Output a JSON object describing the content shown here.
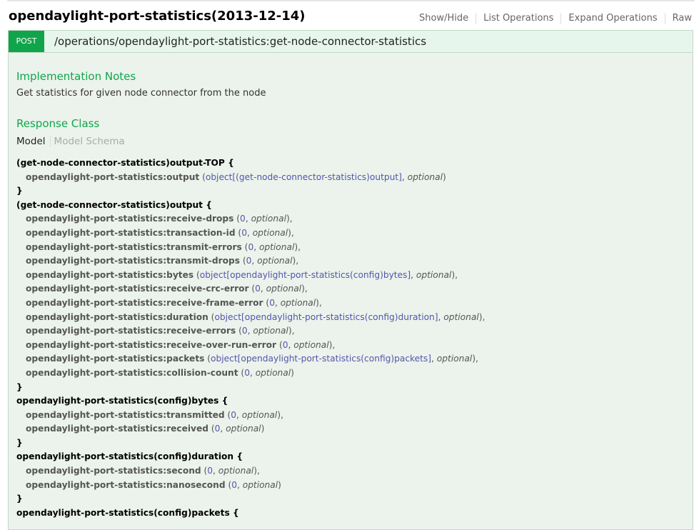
{
  "header": {
    "title": "opendaylight-port-statistics(2013-12-14)",
    "actions": [
      "Show/Hide",
      "List Operations",
      "Expand Operations",
      "Raw"
    ]
  },
  "operation": {
    "method": "POST",
    "path": "/operations/opendaylight-port-statistics:get-node-connector-statistics",
    "notes_heading": "Implementation Notes",
    "notes_text": "Get statistics for given node connector from the node",
    "response_heading": "Response Class",
    "tab_model": "Model",
    "tab_schema": "Model Schema"
  },
  "model_lines": [
    {
      "kind": "head",
      "text": "(get-node-connector-statistics)output-TOP {"
    },
    {
      "kind": "prop",
      "name": "opendaylight-port-statistics:output",
      "type": "object[(get-node-connector-statistics)output]",
      "opt": "optional",
      "trail": ")"
    },
    {
      "kind": "close",
      "text": "}"
    },
    {
      "kind": "head",
      "text": "(get-node-connector-statistics)output {"
    },
    {
      "kind": "prop",
      "name": "opendaylight-port-statistics:receive-drops",
      "type": "0",
      "opt": "optional",
      "trail": "),"
    },
    {
      "kind": "prop",
      "name": "opendaylight-port-statistics:transaction-id",
      "type": "0",
      "opt": "optional",
      "trail": "),"
    },
    {
      "kind": "prop",
      "name": "opendaylight-port-statistics:transmit-errors",
      "type": "0",
      "opt": "optional",
      "trail": "),"
    },
    {
      "kind": "prop",
      "name": "opendaylight-port-statistics:transmit-drops",
      "type": "0",
      "opt": "optional",
      "trail": "),"
    },
    {
      "kind": "prop",
      "name": "opendaylight-port-statistics:bytes",
      "type": "object[opendaylight-port-statistics(config)bytes]",
      "opt": "optional",
      "trail": "),"
    },
    {
      "kind": "prop",
      "name": "opendaylight-port-statistics:receive-crc-error",
      "type": "0",
      "opt": "optional",
      "trail": "),"
    },
    {
      "kind": "prop",
      "name": "opendaylight-port-statistics:receive-frame-error",
      "type": "0",
      "opt": "optional",
      "trail": "),"
    },
    {
      "kind": "prop",
      "name": "opendaylight-port-statistics:duration",
      "type": "object[opendaylight-port-statistics(config)duration]",
      "opt": "optional",
      "trail": "),"
    },
    {
      "kind": "prop",
      "name": "opendaylight-port-statistics:receive-errors",
      "type": "0",
      "opt": "optional",
      "trail": "),"
    },
    {
      "kind": "prop",
      "name": "opendaylight-port-statistics:receive-over-run-error",
      "type": "0",
      "opt": "optional",
      "trail": "),"
    },
    {
      "kind": "prop",
      "name": "opendaylight-port-statistics:packets",
      "type": "object[opendaylight-port-statistics(config)packets]",
      "opt": "optional",
      "trail": "),"
    },
    {
      "kind": "prop",
      "name": "opendaylight-port-statistics:collision-count",
      "type": "0",
      "opt": "optional",
      "trail": ")"
    },
    {
      "kind": "close",
      "text": "}"
    },
    {
      "kind": "head",
      "text": "opendaylight-port-statistics(config)bytes {"
    },
    {
      "kind": "prop",
      "name": "opendaylight-port-statistics:transmitted",
      "type": "0",
      "opt": "optional",
      "trail": "),"
    },
    {
      "kind": "prop",
      "name": "opendaylight-port-statistics:received",
      "type": "0",
      "opt": "optional",
      "trail": ")"
    },
    {
      "kind": "close",
      "text": "}"
    },
    {
      "kind": "head",
      "text": "opendaylight-port-statistics(config)duration {"
    },
    {
      "kind": "prop",
      "name": "opendaylight-port-statistics:second",
      "type": "0",
      "opt": "optional",
      "trail": "),"
    },
    {
      "kind": "prop",
      "name": "opendaylight-port-statistics:nanosecond",
      "type": "0",
      "opt": "optional",
      "trail": ")"
    },
    {
      "kind": "close",
      "text": "}"
    },
    {
      "kind": "head",
      "text": "opendaylight-port-statistics(config)packets {"
    }
  ]
}
